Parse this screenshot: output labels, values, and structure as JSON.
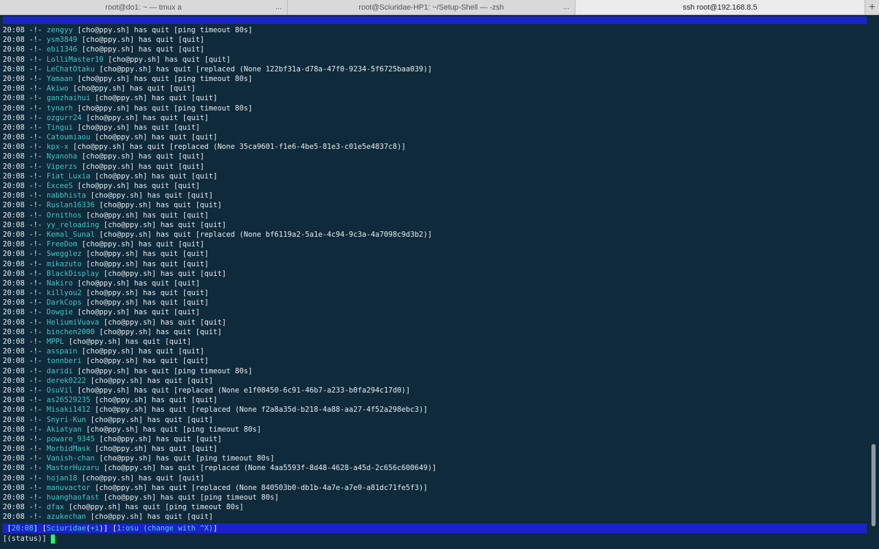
{
  "tabs": [
    {
      "title": "root@do1: ~ — tmux a",
      "more": "..."
    },
    {
      "title": "root@Sciuridae-HP1: ~/Setup-Shell — -zsh",
      "more": "..."
    },
    {
      "title": "ssh root@192.168.8.5",
      "more": ""
    }
  ],
  "new_tab": "+",
  "log": [
    {
      "time": "20:08",
      "arrow": "-!-",
      "nick": "zengyy",
      "host": "cho@ppy.sh",
      "text": "has quit",
      "reason": "ping timeout 80s"
    },
    {
      "time": "20:08",
      "arrow": "-!-",
      "nick": "ysm3849",
      "host": "cho@ppy.sh",
      "text": "has quit",
      "reason": "quit"
    },
    {
      "time": "20:08",
      "arrow": "-!-",
      "nick": "ebi1346",
      "host": "cho@ppy.sh",
      "text": "has quit",
      "reason": "quit"
    },
    {
      "time": "20:08",
      "arrow": "-!-",
      "nick": "LolliMaster10",
      "host": "cho@ppy.sh",
      "text": "has quit",
      "reason": "quit"
    },
    {
      "time": "20:08",
      "arrow": "-!-",
      "nick": "LeChatOtaku",
      "host": "cho@ppy.sh",
      "text": "has quit",
      "reason": "replaced (None 122bf31a-d78a-47f0-9234-5f6725baa039)"
    },
    {
      "time": "20:08",
      "arrow": "-!-",
      "nick": "Yamaan",
      "host": "cho@ppy.sh",
      "text": "has quit",
      "reason": "ping timeout 80s"
    },
    {
      "time": "20:08",
      "arrow": "-!-",
      "nick": "Akiwo",
      "host": "cho@ppy.sh",
      "text": "has quit",
      "reason": "quit"
    },
    {
      "time": "20:08",
      "arrow": "-!-",
      "nick": "ganzhaihui",
      "host": "cho@ppy.sh",
      "text": "has quit",
      "reason": "quit"
    },
    {
      "time": "20:08",
      "arrow": "-!-",
      "nick": "tynarh",
      "host": "cho@ppy.sh",
      "text": "has quit",
      "reason": "ping timeout 80s"
    },
    {
      "time": "20:08",
      "arrow": "-!-",
      "nick": "ozgurr24",
      "host": "cho@ppy.sh",
      "text": "has quit",
      "reason": "quit"
    },
    {
      "time": "20:08",
      "arrow": "-!-",
      "nick": "Tingui",
      "host": "cho@ppy.sh",
      "text": "has quit",
      "reason": "quit"
    },
    {
      "time": "20:08",
      "arrow": "-!-",
      "nick": "Catoumiaou",
      "host": "cho@ppy.sh",
      "text": "has quit",
      "reason": "quit"
    },
    {
      "time": "20:08",
      "arrow": "-!-",
      "nick": "kpx-x",
      "host": "cho@ppy.sh",
      "text": "has quit",
      "reason": "replaced (None 35ca9601-f1e6-4be5-81e3-c01e5e4837c8)"
    },
    {
      "time": "20:08",
      "arrow": "-!-",
      "nick": "Nyanoha",
      "host": "cho@ppy.sh",
      "text": "has quit",
      "reason": "quit"
    },
    {
      "time": "20:08",
      "arrow": "-!-",
      "nick": "Viperzs",
      "host": "cho@ppy.sh",
      "text": "has quit",
      "reason": "quit"
    },
    {
      "time": "20:08",
      "arrow": "-!-",
      "nick": "Fiat_Luxia",
      "host": "cho@ppy.sh",
      "text": "has quit",
      "reason": "quit"
    },
    {
      "time": "20:08",
      "arrow": "-!-",
      "nick": "ExceeS",
      "host": "cho@ppy.sh",
      "text": "has quit",
      "reason": "quit"
    },
    {
      "time": "20:08",
      "arrow": "-!-",
      "nick": "nabbhista",
      "host": "cho@ppy.sh",
      "text": "has quit",
      "reason": "quit"
    },
    {
      "time": "20:08",
      "arrow": "-!-",
      "nick": "Ruslan16336",
      "host": "cho@ppy.sh",
      "text": "has quit",
      "reason": "quit"
    },
    {
      "time": "20:08",
      "arrow": "-!-",
      "nick": "Ornithos",
      "host": "cho@ppy.sh",
      "text": "has quit",
      "reason": "quit"
    },
    {
      "time": "20:08",
      "arrow": "-!-",
      "nick": "yy_reloading",
      "host": "cho@ppy.sh",
      "text": "has quit",
      "reason": "quit"
    },
    {
      "time": "20:08",
      "arrow": "-!-",
      "nick": "Kemal_Sunal",
      "host": "cho@ppy.sh",
      "text": "has quit",
      "reason": "replaced (None bf6119a2-5a1e-4c94-9c3a-4a7098c9d3b2)"
    },
    {
      "time": "20:08",
      "arrow": "-!-",
      "nick": "FreeDom",
      "host": "cho@ppy.sh",
      "text": "has quit",
      "reason": "quit"
    },
    {
      "time": "20:08",
      "arrow": "-!-",
      "nick": "Swegglez",
      "host": "cho@ppy.sh",
      "text": "has quit",
      "reason": "quit"
    },
    {
      "time": "20:08",
      "arrow": "-!-",
      "nick": "mikazuto",
      "host": "cho@ppy.sh",
      "text": "has quit",
      "reason": "quit"
    },
    {
      "time": "20:08",
      "arrow": "-!-",
      "nick": "BlackDisplay",
      "host": "cho@ppy.sh",
      "text": "has quit",
      "reason": "quit"
    },
    {
      "time": "20:08",
      "arrow": "-!-",
      "nick": "Nakiro",
      "host": "cho@ppy.sh",
      "text": "has quit",
      "reason": "quit"
    },
    {
      "time": "20:08",
      "arrow": "-!-",
      "nick": "killyou2",
      "host": "cho@ppy.sh",
      "text": "has quit",
      "reason": "quit"
    },
    {
      "time": "20:08",
      "arrow": "-!-",
      "nick": "DarkCops",
      "host": "cho@ppy.sh",
      "text": "has quit",
      "reason": "quit"
    },
    {
      "time": "20:08",
      "arrow": "-!-",
      "nick": "Dowgie",
      "host": "cho@ppy.sh",
      "text": "has quit",
      "reason": "quit"
    },
    {
      "time": "20:08",
      "arrow": "-!-",
      "nick": "HeliumiVuava",
      "host": "cho@ppy.sh",
      "text": "has quit",
      "reason": "quit"
    },
    {
      "time": "20:08",
      "arrow": "-!-",
      "nick": "binchen2000",
      "host": "cho@ppy.sh",
      "text": "has quit",
      "reason": "quit"
    },
    {
      "time": "20:08",
      "arrow": "-!-",
      "nick": "MPPL",
      "host": "cho@ppy.sh",
      "text": "has quit",
      "reason": "quit"
    },
    {
      "time": "20:08",
      "arrow": "-!-",
      "nick": "asspain",
      "host": "cho@ppy.sh",
      "text": "has quit",
      "reason": "quit"
    },
    {
      "time": "20:08",
      "arrow": "-!-",
      "nick": "tonnberi",
      "host": "cho@ppy.sh",
      "text": "has quit",
      "reason": "quit"
    },
    {
      "time": "20:08",
      "arrow": "-!-",
      "nick": "daridi",
      "host": "cho@ppy.sh",
      "text": "has quit",
      "reason": "ping timeout 80s"
    },
    {
      "time": "20:08",
      "arrow": "-!-",
      "nick": "derek0222",
      "host": "cho@ppy.sh",
      "text": "has quit",
      "reason": "quit"
    },
    {
      "time": "20:08",
      "arrow": "-!-",
      "nick": "OsuVil",
      "host": "cho@ppy.sh",
      "text": "has quit",
      "reason": "replaced (None e1f08450-6c91-46b7-a233-b0fa294c17d0)"
    },
    {
      "time": "20:08",
      "arrow": "-!-",
      "nick": "as26529235",
      "host": "cho@ppy.sh",
      "text": "has quit",
      "reason": "quit"
    },
    {
      "time": "20:08",
      "arrow": "-!-",
      "nick": "Misaki1412",
      "host": "cho@ppy.sh",
      "text": "has quit",
      "reason": "replaced (None f2a8a35d-b218-4a88-aa27-4f52a298ebc3)"
    },
    {
      "time": "20:08",
      "arrow": "-!-",
      "nick": "Snyri-Kun",
      "host": "cho@ppy.sh",
      "text": "has quit",
      "reason": "quit"
    },
    {
      "time": "20:08",
      "arrow": "-!-",
      "nick": "Akiatyan",
      "host": "cho@ppy.sh",
      "text": "has quit",
      "reason": "ping timeout 80s"
    },
    {
      "time": "20:08",
      "arrow": "-!-",
      "nick": "poware_9345",
      "host": "cho@ppy.sh",
      "text": "has quit",
      "reason": "quit"
    },
    {
      "time": "20:08",
      "arrow": "-!-",
      "nick": "MorbidMask",
      "host": "cho@ppy.sh",
      "text": "has quit",
      "reason": "quit"
    },
    {
      "time": "20:08",
      "arrow": "-!-",
      "nick": "Vanish-chan",
      "host": "cho@ppy.sh",
      "text": "has quit",
      "reason": "ping timeout 80s"
    },
    {
      "time": "20:08",
      "arrow": "-!-",
      "nick": "MasterHuzaru",
      "host": "cho@ppy.sh",
      "text": "has quit",
      "reason": "replaced (None 4aa5593f-8d48-4628-a45d-2c656c600649)"
    },
    {
      "time": "20:08",
      "arrow": "-!-",
      "nick": "hojan18",
      "host": "cho@ppy.sh",
      "text": "has quit",
      "reason": "quit"
    },
    {
      "time": "20:08",
      "arrow": "-!-",
      "nick": "manuvactor",
      "host": "cho@ppy.sh",
      "text": "has quit",
      "reason": "replaced (None 840503b0-db1b-4a7e-a7e0-a81dc71fe5f3)"
    },
    {
      "time": "20:08",
      "arrow": "-!-",
      "nick": "huanghaofast",
      "host": "cho@ppy.sh",
      "text": "has quit",
      "reason": "ping timeout 80s"
    },
    {
      "time": "20:08",
      "arrow": "-!-",
      "nick": "dfax",
      "host": "cho@ppy.sh",
      "text": "has quit",
      "reason": "ping timeout 80s"
    },
    {
      "time": "20:08",
      "arrow": "-!-",
      "nick": "azukechan",
      "host": "cho@ppy.sh",
      "text": "has quit",
      "reason": "quit"
    }
  ],
  "statusbar": {
    "clock": "20:08",
    "nick": "Sciuridae",
    "mode": "+i",
    "window": "1:osu",
    "hint": "(change with ^X)"
  },
  "prompt": {
    "label": "[(status)]"
  },
  "colors": {
    "background": "#0f2a3a",
    "nick": "#3fc7c9",
    "statusbar": "#1a23c9",
    "cursor": "#19ff6a"
  }
}
